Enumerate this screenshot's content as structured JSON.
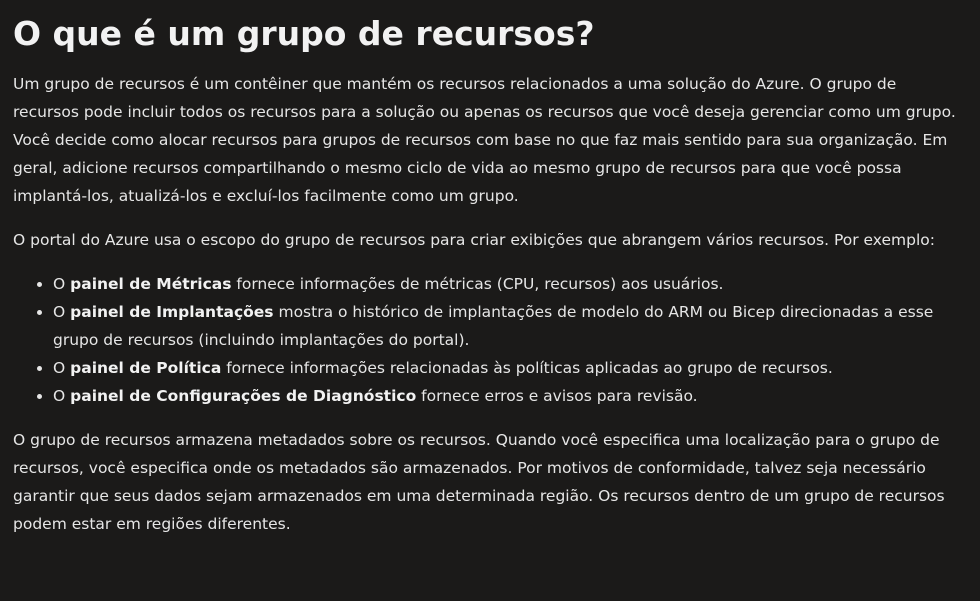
{
  "title": "O que é um grupo de recursos?",
  "paragraph1": "Um grupo de recursos é um contêiner que mantém os recursos relacionados a uma solução do Azure. O grupo de recursos pode incluir todos os recursos para a solução ou apenas os recursos que você deseja gerenciar como um grupo. Você decide como alocar recursos para grupos de recursos com base no que faz mais sentido para sua organização. Em geral, adicione recursos compartilhando o mesmo ciclo de vida ao mesmo grupo de recursos para que você possa implantá-los, atualizá-los e excluí-los facilmente como um grupo.",
  "paragraph2": "O portal do Azure usa o escopo do grupo de recursos para criar exibições que abrangem vários recursos. Por exemplo:",
  "bullets": [
    {
      "prefix": "O ",
      "bold": "painel de Métricas",
      "rest": " fornece informações de métricas (CPU, recursos) aos usuários."
    },
    {
      "prefix": "O ",
      "bold": "painel de Implantações",
      "rest": " mostra o histórico de implantações de modelo do ARM ou Bicep direcionadas a esse grupo de recursos (incluindo implantações do portal)."
    },
    {
      "prefix": "O ",
      "bold": "painel de Política",
      "rest": " fornece informações relacionadas às políticas aplicadas ao grupo de recursos."
    },
    {
      "prefix": "O ",
      "bold": "painel de Configurações de Diagnóstico",
      "rest": " fornece erros e avisos para revisão."
    }
  ],
  "paragraph3": "O grupo de recursos armazena metadados sobre os recursos. Quando você especifica uma localização para o grupo de recursos, você especifica onde os metadados são armazenados. Por motivos de conformidade, talvez seja necessário garantir que seus dados sejam armazenados em uma determinada região. Os recursos dentro de um grupo de recursos podem estar em regiões diferentes."
}
